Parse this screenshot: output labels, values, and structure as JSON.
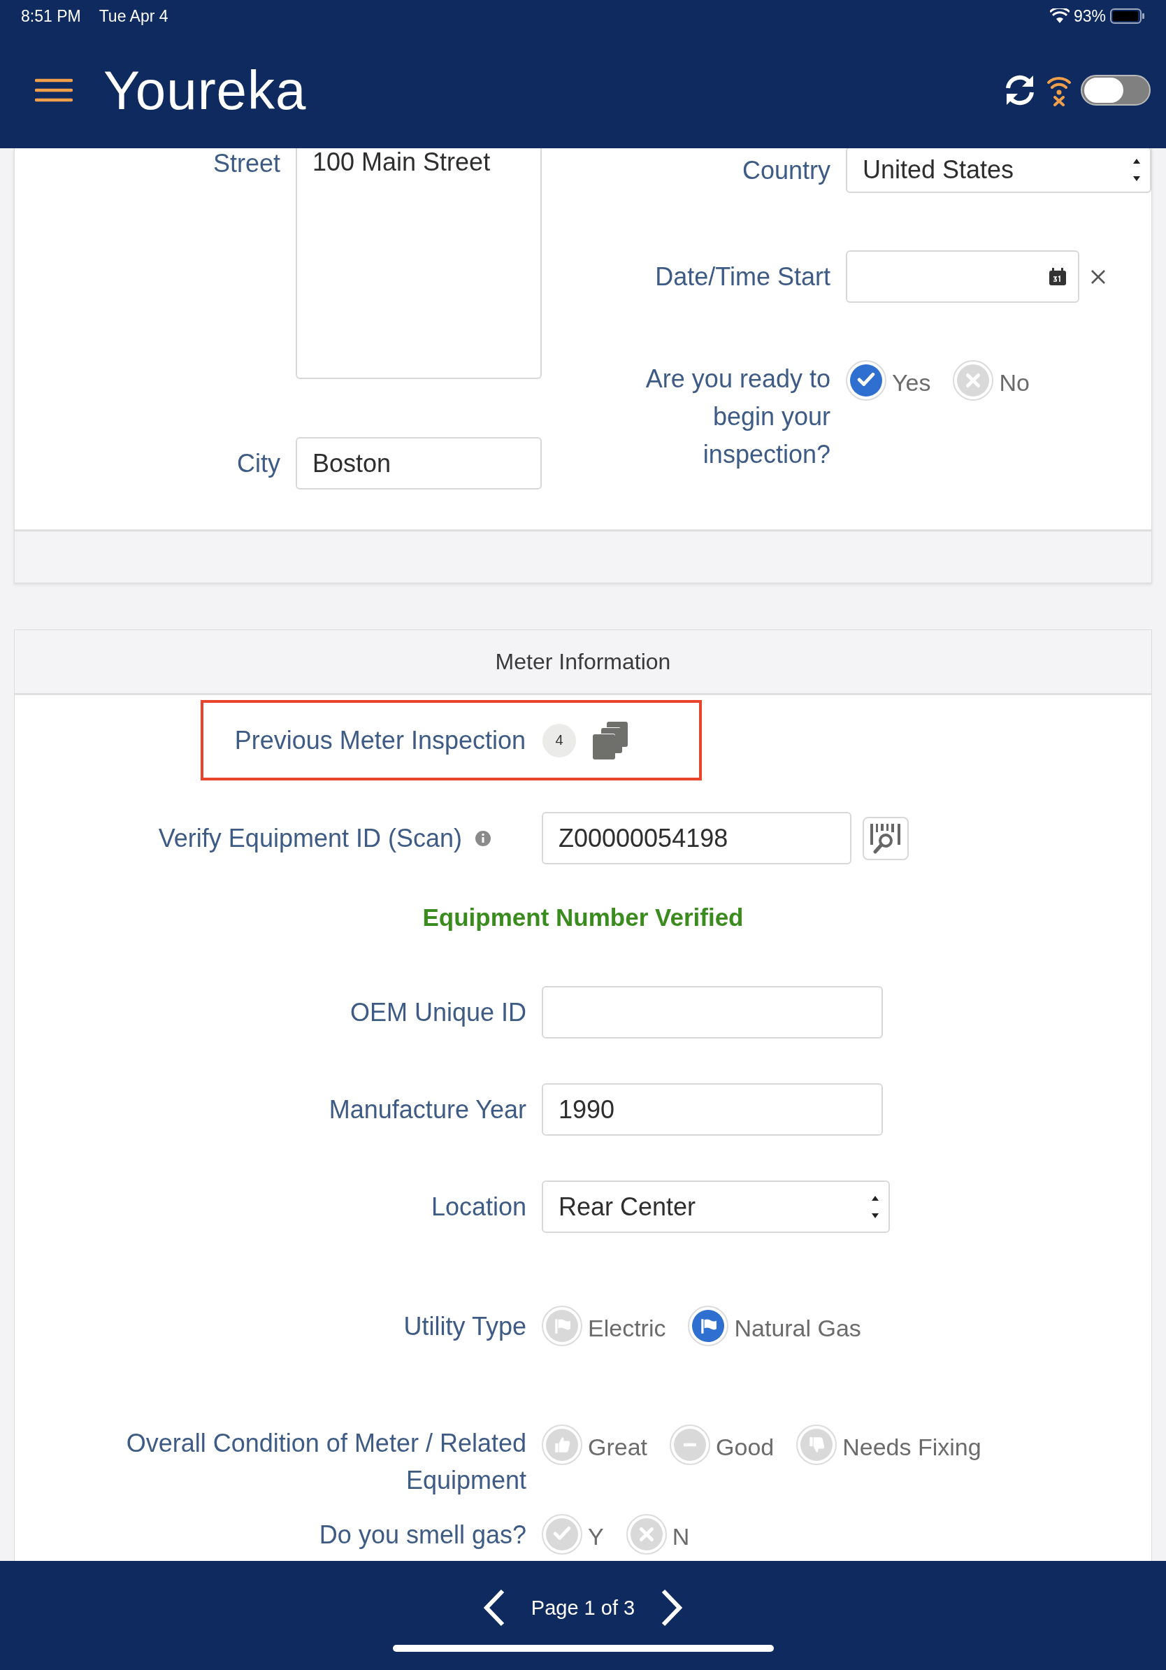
{
  "status_bar": {
    "time": "8:51 PM",
    "date": "Tue Apr 4",
    "battery": "93%"
  },
  "app_bar": {
    "title": "Youreka",
    "offline_toggle": {
      "on": false
    }
  },
  "address_section": {
    "left_fields": [
      {
        "kind": "textarea",
        "label": "Street",
        "value": "100 Main Street"
      },
      {
        "kind": "text",
        "label": "City",
        "value": "Boston"
      }
    ],
    "right_fields": [
      {
        "kind": "select",
        "label": "Country",
        "value": "United States"
      },
      {
        "kind": "datetime",
        "label": "Date/Time Start"
      },
      {
        "kind": "radio",
        "label": "Are you ready to begin your inspection?",
        "options": [
          {
            "label": "Yes",
            "selected": true
          },
          {
            "label": "No",
            "selected": false
          }
        ]
      }
    ]
  },
  "meter_section": {
    "title": "Meter Information",
    "rows": [
      {
        "kind": "related",
        "label": "Previous Meter Inspection",
        "count": "4",
        "highlighted": true
      },
      {
        "kind": "scan",
        "label": "Verify Equipment ID (Scan)",
        "value": "Z00000054198"
      },
      {
        "kind": "message",
        "text": "Equipment Number Verified"
      },
      {
        "kind": "text",
        "label": "OEM Unique ID"
      },
      {
        "kind": "text",
        "label": "Manufacture Year",
        "value": "1990"
      },
      {
        "kind": "select",
        "label": "Location",
        "value": "Rear Center"
      },
      {
        "kind": "radio",
        "label": "Utility Type",
        "options": [
          {
            "label": "Electric",
            "selected": false
          },
          {
            "label": "Natural Gas",
            "selected": true
          }
        ]
      },
      {
        "kind": "radio",
        "label": "Overall Condition of Meter / Related Equipment",
        "options": [
          {
            "label": "Great",
            "selected": false
          },
          {
            "label": "Good",
            "selected": false
          },
          {
            "label": "Needs Fixing",
            "selected": false
          }
        ]
      },
      {
        "kind": "radio",
        "label": "Do you smell gas?",
        "options": [
          {
            "label": "Y",
            "selected": false
          },
          {
            "label": "N",
            "selected": false
          }
        ]
      }
    ]
  },
  "pager": {
    "text": "Page 1 of 3"
  }
}
